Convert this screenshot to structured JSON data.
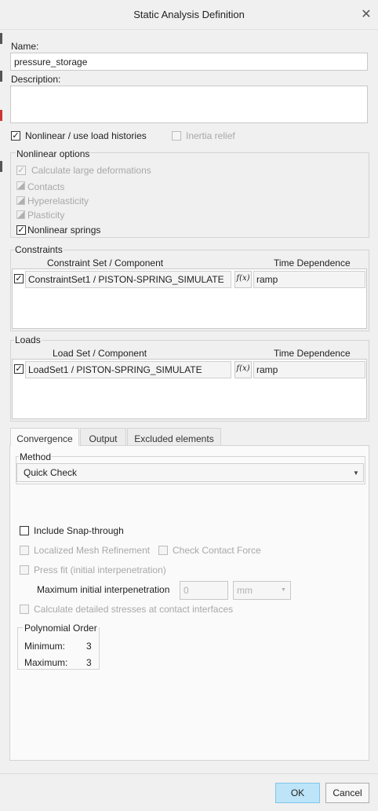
{
  "window": {
    "title": "Static Analysis Definition",
    "close_glyph": "✕"
  },
  "name_field": {
    "label": "Name:",
    "value": "pressure_storage"
  },
  "description_field": {
    "label": "Description:",
    "value": ""
  },
  "nonlinear_checkbox": {
    "label": "Nonlinear / use load histories",
    "checked": true
  },
  "inertia_checkbox": {
    "label": "Inertia relief",
    "checked": false
  },
  "nonlinear_options": {
    "title": "Nonlinear options",
    "large_deformations": "Calculate large deformations",
    "contacts": "Contacts",
    "hyperelasticity": "Hyperelasticity",
    "plasticity": "Plasticity",
    "nonlinear_springs": "Nonlinear springs"
  },
  "constraints": {
    "title": "Constraints",
    "col_component": "Constraint Set / Component",
    "col_time": "Time Dependence",
    "rows": [
      {
        "component": "ConstraintSet1 / PISTON-SPRING_SIMULATE",
        "fx": "f(x)",
        "time": "ramp"
      }
    ]
  },
  "loads": {
    "title": "Loads",
    "col_component": "Load Set / Component",
    "col_time": "Time Dependence",
    "rows": [
      {
        "component": "LoadSet1 / PISTON-SPRING_SIMULATE",
        "fx": "f(x)",
        "time": "ramp"
      }
    ]
  },
  "tabs": [
    "Convergence",
    "Output",
    "Excluded elements"
  ],
  "convergence": {
    "method_label": "Method",
    "method_value": "Quick Check",
    "snap_through": "Include Snap-through",
    "localized_mesh": "Localized Mesh Refinement",
    "check_contact": "Check Contact Force",
    "press_fit": "Press fit (initial interpenetration)",
    "max_interp_label": "Maximum initial interpenetration",
    "max_interp_value": "0",
    "max_interp_unit": "mm",
    "detailed_stresses": "Calculate detailed stresses at contact interfaces",
    "poly_title": "Polynomial Order",
    "poly_min_label": "Minimum:",
    "poly_min_value": "3",
    "poly_max_label": "Maximum:",
    "poly_max_value": "3"
  },
  "buttons": {
    "ok": "OK",
    "cancel": "Cancel"
  }
}
